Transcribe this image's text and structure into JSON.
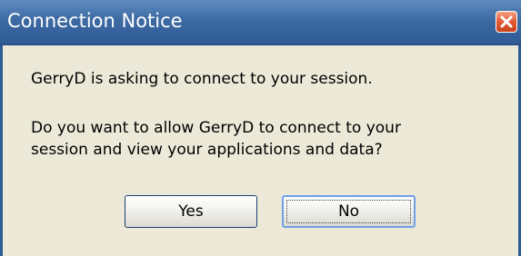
{
  "dialog": {
    "title": "Connection Notice",
    "close_icon": "close-icon",
    "message_line1": "GerryD is asking to connect to your session.",
    "message_line2": "Do you want to allow GerryD to connect to your",
    "message_line3": "session and view your applications and data?",
    "yes_label": "Yes",
    "no_label": "No",
    "colors": {
      "titlebar": "#3d6aa3",
      "body": "#ece9d8",
      "close": "#e05a34"
    }
  }
}
